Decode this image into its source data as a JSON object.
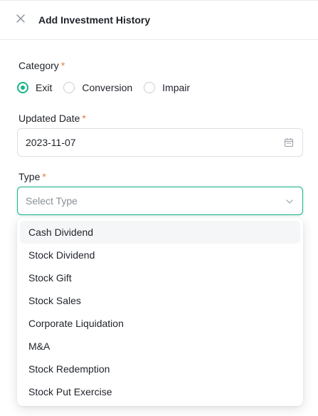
{
  "header": {
    "title": "Add Investment History",
    "close_icon": "close-icon"
  },
  "form": {
    "category": {
      "label": "Category",
      "required_mark": "*",
      "options": [
        {
          "label": "Exit",
          "checked": true
        },
        {
          "label": "Conversion",
          "checked": false
        },
        {
          "label": "Impair",
          "checked": false
        }
      ]
    },
    "updated_date": {
      "label": "Updated Date",
      "required_mark": "*",
      "value": "2023-11-07",
      "icon": "calendar-icon"
    },
    "type": {
      "label": "Type",
      "required_mark": "*",
      "placeholder": "Select Type",
      "icon": "chevron-down-icon",
      "options": [
        "Cash Dividend",
        "Stock Dividend",
        "Stock Gift",
        "Stock Sales",
        "Corporate Liquidation",
        "M&A",
        "Stock Redemption",
        "Stock Put Exercise"
      ],
      "highlighted_option": "Cash Dividend"
    }
  },
  "colors": {
    "accent": "#19b48a",
    "required": "#e8793e",
    "text": "#1f2329",
    "placeholder": "#8a8f98",
    "border": "#dcdfe4"
  }
}
